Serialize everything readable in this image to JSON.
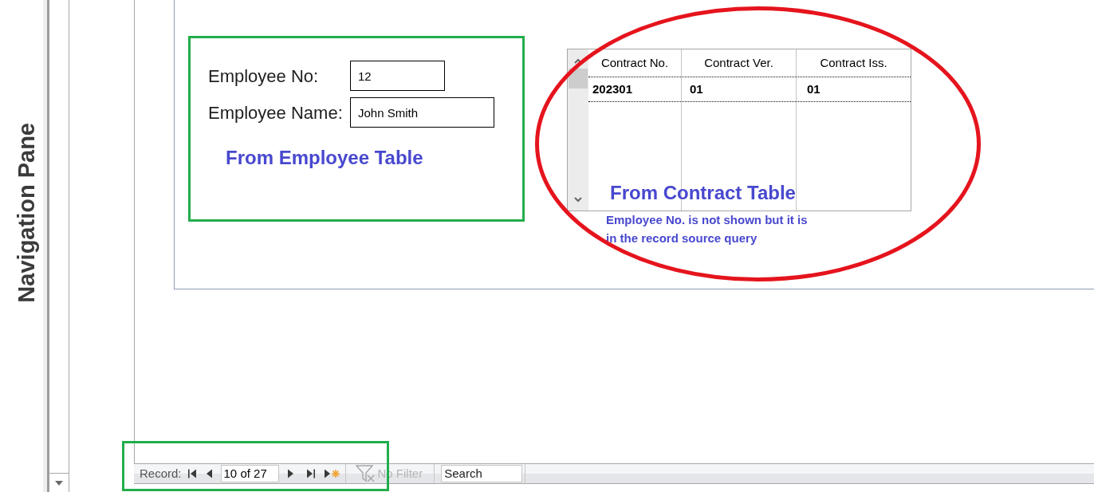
{
  "navigation_pane": {
    "title": "Navigation Pane"
  },
  "employee_form": {
    "fields": [
      {
        "label": "Employee No:",
        "value": "12"
      },
      {
        "label": "Employee Name:",
        "value": "John Smith"
      }
    ],
    "note": "From Employee Table"
  },
  "contract_subform": {
    "columns": [
      "Contract No.",
      "Contract Ver.",
      "Contract Iss."
    ],
    "rows": [
      {
        "cells": [
          "202301",
          "01",
          "01"
        ],
        "selected": true
      }
    ],
    "note": "From Contract Table",
    "detail": "Employee No. is not shown but it is in the record source query"
  },
  "record_navigator": {
    "label": "Record:",
    "current": "10 of 27",
    "filter": {
      "label": "No Filter",
      "applied": false
    },
    "search": {
      "placeholder": "Search"
    }
  }
}
